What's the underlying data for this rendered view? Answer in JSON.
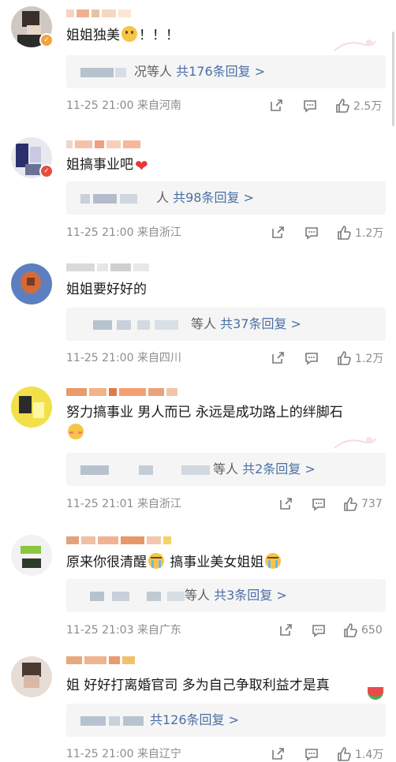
{
  "comments": [
    {
      "text": "姐姐独美",
      "text_suffix": "！！！",
      "reply_who": "况等人",
      "reply_count": "共176条回复 >",
      "time": "11-25 21:00",
      "location": "来自河南",
      "likes": "2.5万",
      "verified": true
    },
    {
      "text": "姐搞事业吧",
      "text_suffix": "",
      "reply_who": "人",
      "reply_count": "共98条回复 >",
      "time": "11-25 21:00",
      "location": "来自浙江",
      "likes": "1.2万",
      "verified": true
    },
    {
      "text": "姐姐要好好的",
      "text_suffix": "",
      "reply_who": "等人",
      "reply_count": "共37条回复 >",
      "time": "11-25 21:00",
      "location": "来自四川",
      "likes": "1.2万",
      "verified": false
    },
    {
      "text": "努力搞事业 男人而已 永远是成功路上的绊脚石",
      "text_suffix": "",
      "reply_who": "等人",
      "reply_count": "共2条回复 >",
      "time": "11-25 21:01",
      "location": "来自浙江",
      "likes": "737",
      "verified": false
    },
    {
      "text": "原来你很清醒",
      "text_mid": "搞事业美女姐姐",
      "reply_who": "等人",
      "reply_count": "共3条回复 >",
      "time": "11-25 21:03",
      "location": "来自广东",
      "likes": "650",
      "verified": false
    },
    {
      "text": "姐 好好打离婚官司 多为自己争取利益才是真",
      "text_suffix": "",
      "reply_who": "",
      "reply_count": "共126条回复 >",
      "time": "11-25 21:00",
      "location": "来自辽宁",
      "likes": "1.4万",
      "verified": false
    }
  ],
  "icons": {
    "share": "share-icon",
    "comment": "comment-icon",
    "like": "thumbs-up-icon"
  },
  "colors": {
    "reply_link": "#4a6fa5",
    "meta": "#8c8c8c",
    "reply_bg": "#f5f5f5",
    "badge": "#f2a33a"
  }
}
